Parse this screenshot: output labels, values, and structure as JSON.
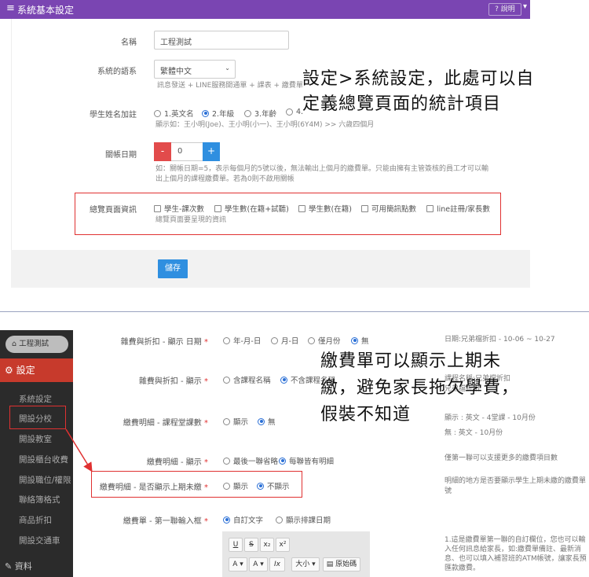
{
  "top": {
    "header": {
      "menu_icon": "≡",
      "title": "系統基本設定",
      "help": "? 說明",
      "chevron": "▾"
    },
    "fields": {
      "name_label": "名稱",
      "name_value": "工程測試",
      "lang_label": "系統的語系",
      "lang_value": "繁體中文",
      "lang_hint": "訊息發送 + LINE服務開通單 + 課表 + 繳費單",
      "name_add_label": "學生姓名加註",
      "name_add_options": [
        "1.英文名",
        "2.年級",
        "3.年齡",
        "4."
      ],
      "name_add_hint": "顯示如：王小明(Joe)、王小明(小一)、王小明(6Y4M) >> 六歲四個月",
      "close_label": "關帳日期",
      "close_minus": "-",
      "close_value": "0",
      "close_plus": "+",
      "close_hint_1": "如：關帳日期=5，表示每個月的5號以後，無法輸出上個月的繳費單。只能由擁有主管簽核的員工才可以輸",
      "close_hint_2": "出上個月的課程繳費單。若為0則不啟用關帳",
      "overview_label": "總覽頁面資訊",
      "overview_options": [
        "學生-課次數",
        "學生數(在籍+試聽)",
        "學生數(在籍)",
        "可用簡訊點數",
        "line註冊/家長數"
      ],
      "overview_hint": "總覽頁面要呈現的資訊"
    },
    "save": "儲存"
  },
  "callout_top_1": "設定>系統設定，此處可以自",
  "callout_top_2": "定義總覽頁面的統計項目",
  "sidebar": {
    "school": "工程測試",
    "settings": "設定",
    "items": [
      "系統設定",
      "開設分校",
      "開設教室",
      "開設櫃台收費",
      "開設職位/權限",
      "聯絡簿格式",
      "商品折扣",
      "開設交通車"
    ],
    "data": "資料"
  },
  "rows": {
    "r1_label": "雜費與折扣 - 顯示 日期",
    "r1_options": [
      "年-月-日",
      "月-日",
      "僅月份",
      "無"
    ],
    "r1_note": "日期:兄弟檔折扣 - 10-06 ~ 10-27",
    "r2_label": "雜費與折扣 - 顯示",
    "r2_options": [
      "含課程名稱",
      "不含課程名稱"
    ],
    "r2_note_1": "課程名稱:兄弟檔折扣",
    "r2_note_2": "兄弟檔折扣",
    "r3_label": "繳費明細 - 課程堂課數",
    "r3_options": [
      "顯示",
      "無"
    ],
    "r3_note_1": "顯示 : 英文 - 4堂課 - 10月份",
    "r3_note_2": "無 : 英文 - 10月份",
    "r4_label": "繳費明細 - 顯示",
    "r4_options": [
      "最後一聯省略",
      "每聯皆有明細"
    ],
    "r4_note": "僅第一聯可以支援更多的繳費項目數",
    "r5_label": "繳費明細 - 是否顯示上期未繳",
    "r5_options": [
      "顯示",
      "不顯示"
    ],
    "r5_note_1": "明細的地方是否要顯示學生上期未繳的繳費單",
    "r5_note_2": "號",
    "r6_label": "繳費單 - 第一聯輸入框",
    "r6_options": [
      "自訂文字",
      "顯示排課日期"
    ],
    "r6_note_1": "1.這是繳費單第一聯的自訂欄位，您也可以輸",
    "r6_note_2": "入任何訊息給家長，如:繳費單備註、最新消",
    "r6_note_3": "息、也可以填入補習班的ATM帳號，讓家長預",
    "r6_note_4": "匯款繳費。",
    "required": "*"
  },
  "editor": {
    "underline": "U",
    "strike": "S",
    "sub": "x₂",
    "sup": "x²",
    "font_color": "A ▾",
    "bg_color": "A ▾",
    "clear": "Ix",
    "size": "大小 ▾",
    "source": "原始碼"
  },
  "callout_bottom_1": "繳費單可以顯示上期未",
  "callout_bottom_2": "繳，避免家長拖欠學費，",
  "callout_bottom_3": "假裝不知道",
  "colors": {
    "header": "#7a45b2",
    "sidebar": "#2b2b2b",
    "active": "#c73a2c",
    "highlight": "#e03131",
    "primary": "#2f8fe0"
  }
}
